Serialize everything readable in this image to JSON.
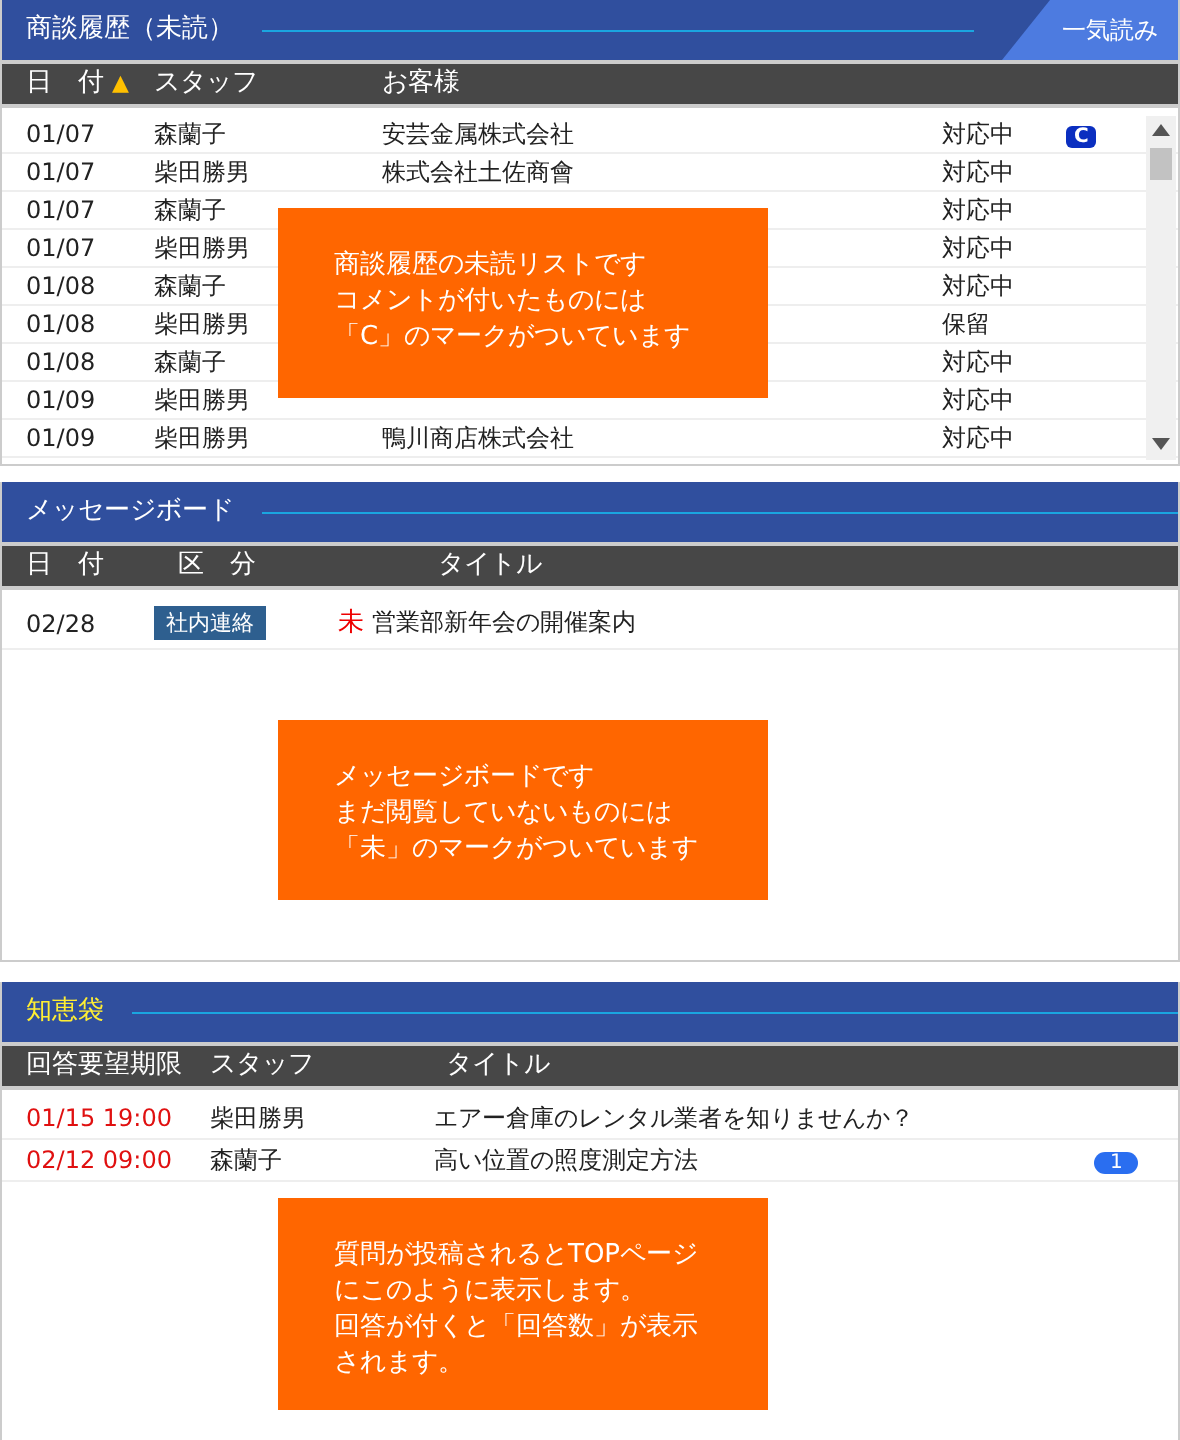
{
  "history": {
    "title": "商談履歴（未読）",
    "read_all_button": "一気読み",
    "columns": [
      "日　付",
      "スタッフ",
      "お客様"
    ],
    "sort_mark": "▲",
    "rows": [
      {
        "date": "01/07",
        "staff": "森蘭子",
        "customer": "安芸金属株式会社",
        "status": "対応中",
        "comment_mark": "C"
      },
      {
        "date": "01/07",
        "staff": "柴田勝男",
        "customer": "株式会社土佐商會",
        "status": "対応中"
      },
      {
        "date": "01/07",
        "staff": "森蘭子",
        "status": "対応中"
      },
      {
        "date": "01/07",
        "staff": "柴田勝男",
        "status": "対応中"
      },
      {
        "date": "01/08",
        "staff": "森蘭子",
        "status": "対応中"
      },
      {
        "date": "01/08",
        "staff": "柴田勝男",
        "status": "保留"
      },
      {
        "date": "01/08",
        "staff": "森蘭子",
        "status": "対応中"
      },
      {
        "date": "01/09",
        "staff": "柴田勝男",
        "status": "対応中"
      },
      {
        "date": "01/09",
        "staff": "柴田勝男",
        "customer": "鴨川商店株式会社",
        "status": "対応中"
      }
    ],
    "callout": [
      "商談履歴の未読リストです",
      "コメントが付いたものには",
      "「C」のマークがついています"
    ]
  },
  "message_board": {
    "title": "メッセージボード",
    "columns": [
      "日　付",
      "区　分",
      "タイトル"
    ],
    "rows": [
      {
        "date": "02/28",
        "category": "社内連絡",
        "unread_mark": "未",
        "title": "営業部新年会の開催案内"
      }
    ],
    "callout": [
      "メッセージボードです",
      "まだ閲覧していないものには",
      "「未」のマークがついています"
    ]
  },
  "knowledge": {
    "title": "知恵袋",
    "columns": [
      "回答要望期限",
      "スタッフ",
      "タイトル"
    ],
    "rows": [
      {
        "deadline": "01/15 19:00",
        "staff": "柴田勝男",
        "title": "エアー倉庫のレンタル業者を知りませんか？"
      },
      {
        "deadline": "02/12 09:00",
        "staff": "森蘭子",
        "title": "高い位置の照度測定方法",
        "answers": "1"
      }
    ],
    "callout": [
      "質問が投稿されるとTOPページ",
      "にこのように表示します。",
      "回答が付くと「回答数」が表示",
      "されます。"
    ]
  }
}
